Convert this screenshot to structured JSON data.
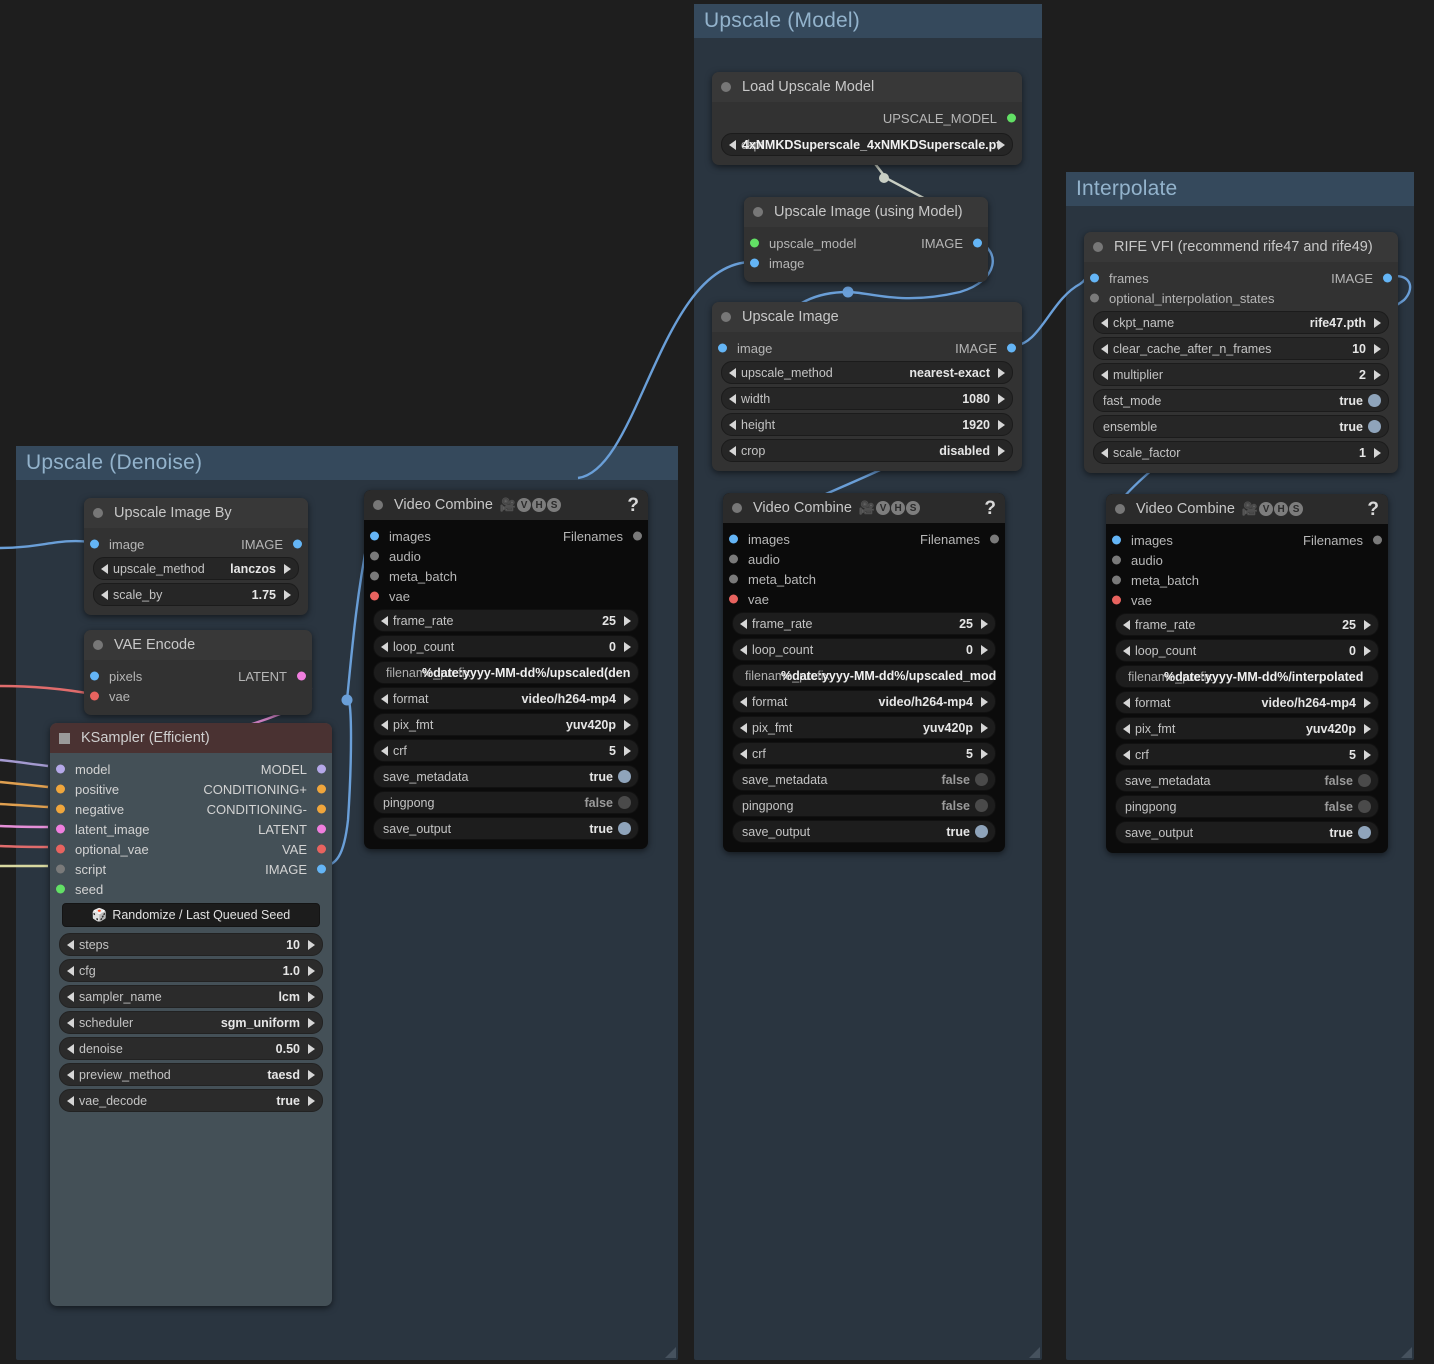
{
  "groups": [
    {
      "id": "upscale_model",
      "title": "Upscale (Model)"
    },
    {
      "id": "interpolate",
      "title": "Interpolate"
    },
    {
      "id": "upscale_denoise",
      "title": "Upscale (Denoise)"
    }
  ],
  "nodes": {
    "load_upscale_model": {
      "title": "Load Upscale Model",
      "outputs": [
        {
          "label": "UPSCALE_MODEL",
          "color": "green"
        }
      ],
      "widgets": [
        {
          "label": "ckpt",
          "value": "4xNMKDSuperscale_4xNMKDSuperscale.pt",
          "type": "combo-overlap"
        }
      ]
    },
    "upscale_image_using_model": {
      "title": "Upscale Image (using Model)",
      "inputs": [
        {
          "label": "upscale_model",
          "color": "green"
        },
        {
          "label": "image",
          "color": "blue"
        }
      ],
      "outputs": [
        {
          "label": "IMAGE",
          "color": "blue"
        }
      ]
    },
    "upscale_image": {
      "title": "Upscale Image",
      "inputs": [
        {
          "label": "image",
          "color": "blue"
        }
      ],
      "outputs": [
        {
          "label": "IMAGE",
          "color": "blue"
        }
      ],
      "widgets": [
        {
          "label": "upscale_method",
          "value": "nearest-exact",
          "type": "combo"
        },
        {
          "label": "width",
          "value": "1080",
          "type": "combo"
        },
        {
          "label": "height",
          "value": "1920",
          "type": "combo"
        },
        {
          "label": "crop",
          "value": "disabled",
          "type": "combo"
        }
      ]
    },
    "rife_vfi": {
      "title": "RIFE VFI (recommend rife47 and rife49)",
      "inputs": [
        {
          "label": "frames",
          "color": "blue"
        },
        {
          "label": "optional_interpolation_states",
          "color": "gray"
        }
      ],
      "outputs": [
        {
          "label": "IMAGE",
          "color": "blue"
        }
      ],
      "widgets": [
        {
          "label": "ckpt_name",
          "value": "rife47.pth",
          "type": "combo"
        },
        {
          "label": "clear_cache_after_n_frames",
          "value": "10",
          "type": "combo"
        },
        {
          "label": "multiplier",
          "value": "2",
          "type": "combo"
        },
        {
          "label": "fast_mode",
          "value": "true",
          "type": "toggle",
          "on": true
        },
        {
          "label": "ensemble",
          "value": "true",
          "type": "toggle",
          "on": true
        },
        {
          "label": "scale_factor",
          "value": "1",
          "type": "combo"
        }
      ]
    },
    "upscale_image_by": {
      "title": "Upscale Image By",
      "inputs": [
        {
          "label": "image",
          "color": "blue"
        }
      ],
      "outputs": [
        {
          "label": "IMAGE",
          "color": "blue"
        }
      ],
      "widgets": [
        {
          "label": "upscale_method",
          "value": "lanczos",
          "type": "combo"
        },
        {
          "label": "scale_by",
          "value": "1.75",
          "type": "combo"
        }
      ]
    },
    "vae_encode": {
      "title": "VAE Encode",
      "inputs": [
        {
          "label": "pixels",
          "color": "blue"
        },
        {
          "label": "vae",
          "color": "red"
        }
      ],
      "outputs": [
        {
          "label": "LATENT",
          "color": "pink"
        }
      ]
    },
    "ksampler_efficient": {
      "title": "KSampler (Efficient)",
      "inputs": [
        {
          "label": "model",
          "color": "purple"
        },
        {
          "label": "positive",
          "color": "orange"
        },
        {
          "label": "negative",
          "color": "orange"
        },
        {
          "label": "latent_image",
          "color": "pink"
        },
        {
          "label": "optional_vae",
          "color": "red"
        },
        {
          "label": "script",
          "color": "gray"
        },
        {
          "label": "seed",
          "color": "green"
        }
      ],
      "outputs": [
        {
          "label": "MODEL",
          "color": "purple"
        },
        {
          "label": "CONDITIONING+",
          "color": "orange"
        },
        {
          "label": "CONDITIONING-",
          "color": "orange"
        },
        {
          "label": "LATENT",
          "color": "pink"
        },
        {
          "label": "VAE",
          "color": "red"
        },
        {
          "label": "IMAGE",
          "color": "blue"
        }
      ],
      "seed_button": "Randomize / Last Queued Seed",
      "widgets": [
        {
          "label": "steps",
          "value": "10",
          "type": "combo"
        },
        {
          "label": "cfg",
          "value": "1.0",
          "type": "combo"
        },
        {
          "label": "sampler_name",
          "value": "lcm",
          "type": "combo"
        },
        {
          "label": "scheduler",
          "value": "sgm_uniform",
          "type": "combo"
        },
        {
          "label": "denoise",
          "value": "0.50",
          "type": "combo"
        },
        {
          "label": "preview_method",
          "value": "taesd",
          "type": "combo"
        },
        {
          "label": "vae_decode",
          "value": "true",
          "type": "combo"
        }
      ]
    },
    "video_combine_denoise": {
      "title": "Video Combine",
      "help": "?",
      "inputs": [
        {
          "label": "images",
          "color": "blue"
        },
        {
          "label": "audio",
          "color": "gray"
        },
        {
          "label": "meta_batch",
          "color": "gray"
        },
        {
          "label": "vae",
          "color": "red"
        }
      ],
      "outputs": [
        {
          "label": "Filenames",
          "color": "gray"
        }
      ],
      "widgets": [
        {
          "label": "frame_rate",
          "value": "25",
          "type": "combo"
        },
        {
          "label": "loop_count",
          "value": "0",
          "type": "combo"
        },
        {
          "label": "filename_prefix",
          "value": "%date:yyyy-MM-dd%/upscaled(den",
          "type": "text"
        },
        {
          "label": "format",
          "value": "video/h264-mp4",
          "type": "combo"
        },
        {
          "label": "pix_fmt",
          "value": "yuv420p",
          "type": "combo"
        },
        {
          "label": "crf",
          "value": "5",
          "type": "combo"
        },
        {
          "label": "save_metadata",
          "value": "true",
          "type": "toggle",
          "on": true
        },
        {
          "label": "pingpong",
          "value": "false",
          "type": "toggle",
          "on": false
        },
        {
          "label": "save_output",
          "value": "true",
          "type": "toggle",
          "on": true
        }
      ]
    },
    "video_combine_model": {
      "title": "Video Combine",
      "help": "?",
      "inputs": [
        {
          "label": "images",
          "color": "blue"
        },
        {
          "label": "audio",
          "color": "gray"
        },
        {
          "label": "meta_batch",
          "color": "gray"
        },
        {
          "label": "vae",
          "color": "red"
        }
      ],
      "outputs": [
        {
          "label": "Filenames",
          "color": "gray"
        }
      ],
      "widgets": [
        {
          "label": "frame_rate",
          "value": "25",
          "type": "combo"
        },
        {
          "label": "loop_count",
          "value": "0",
          "type": "combo"
        },
        {
          "label": "filename_prefix",
          "value": "%date:yyyy-MM-dd%/upscaled_mod",
          "type": "text"
        },
        {
          "label": "format",
          "value": "video/h264-mp4",
          "type": "combo"
        },
        {
          "label": "pix_fmt",
          "value": "yuv420p",
          "type": "combo"
        },
        {
          "label": "crf",
          "value": "5",
          "type": "combo"
        },
        {
          "label": "save_metadata",
          "value": "false",
          "type": "toggle",
          "on": false
        },
        {
          "label": "pingpong",
          "value": "false",
          "type": "toggle",
          "on": false
        },
        {
          "label": "save_output",
          "value": "true",
          "type": "toggle",
          "on": true
        }
      ]
    },
    "video_combine_interpolate": {
      "title": "Video Combine",
      "help": "?",
      "inputs": [
        {
          "label": "images",
          "color": "blue"
        },
        {
          "label": "audio",
          "color": "gray"
        },
        {
          "label": "meta_batch",
          "color": "gray"
        },
        {
          "label": "vae",
          "color": "red"
        }
      ],
      "outputs": [
        {
          "label": "Filenames",
          "color": "gray"
        }
      ],
      "widgets": [
        {
          "label": "frame_rate",
          "value": "25",
          "type": "combo"
        },
        {
          "label": "loop_count",
          "value": "0",
          "type": "combo"
        },
        {
          "label": "filename_prefix",
          "value": "%date:yyyy-MM-dd%/interpolated",
          "type": "text"
        },
        {
          "label": "format",
          "value": "video/h264-mp4",
          "type": "combo"
        },
        {
          "label": "pix_fmt",
          "value": "yuv420p",
          "type": "combo"
        },
        {
          "label": "crf",
          "value": "5",
          "type": "combo"
        },
        {
          "label": "save_metadata",
          "value": "false",
          "type": "toggle",
          "on": false
        },
        {
          "label": "pingpong",
          "value": "false",
          "type": "toggle",
          "on": false
        },
        {
          "label": "save_output",
          "value": "true",
          "type": "toggle",
          "on": true
        }
      ]
    }
  },
  "icons": {
    "camera": "🎥",
    "vhs": [
      "V",
      "H",
      "S"
    ],
    "dice": "🎲",
    "recycle": "♻"
  },
  "colors": {
    "canvas": "#1e1e1e",
    "group_body": "#2a3540",
    "group_title": "#35495c",
    "group_text": "#93b3cc",
    "node_body": "#303030",
    "node_header": "#383838",
    "ksampler_body": "#445057",
    "ksampler_header": "#4a3232",
    "vhs_body": "#0b0b0b",
    "link_blue": "#6a9fd8",
    "link_red": "#e06c6c",
    "link_pink": "#e58fd8",
    "link_orange": "#e0a050",
    "link_purple": "#a49ad0",
    "link_gray": "#9aa89a"
  }
}
